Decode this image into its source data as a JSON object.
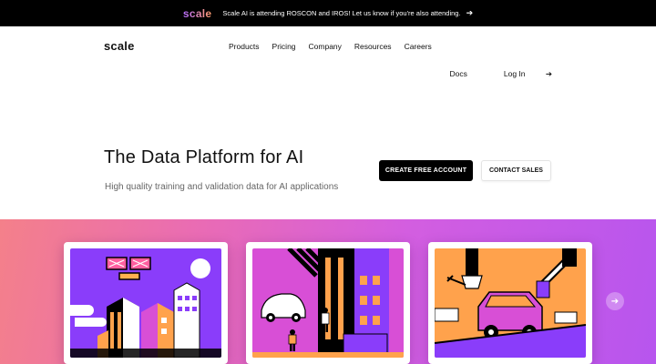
{
  "announcement": {
    "logo": "scale",
    "text": "Scale AI is attending ROSCON and IROS! Let us know if you're also attending.",
    "arrow_icon": "arrow-right-icon"
  },
  "header": {
    "logo": "scale",
    "nav": [
      "Products",
      "Pricing",
      "Company",
      "Resources",
      "Careers"
    ],
    "docs": "Docs",
    "login": "Log In",
    "login_arrow": "➔"
  },
  "hero": {
    "title": "The Data Platform for AI",
    "subtitle": "High quality training and validation data for AI applications",
    "create_account": "CREATE FREE ACCOUNT",
    "contact_sales": "CONTACT SALES"
  },
  "carousel": {
    "next_icon": "arrow-right-circle-icon",
    "next_glyph": "➔",
    "cards": [
      {
        "illustration": "aerial-city-drone-illustration"
      },
      {
        "illustration": "autonomous-car-street-illustration"
      },
      {
        "illustration": "robot-arm-car-assembly-illustration"
      }
    ]
  },
  "colors": {
    "gradient_start": "#f4808a",
    "gradient_end": "#b755ee",
    "illustration_purple": "#8a3dfa",
    "illustration_orange": "#ffa24c",
    "illustration_magenta": "#d84fd6"
  }
}
